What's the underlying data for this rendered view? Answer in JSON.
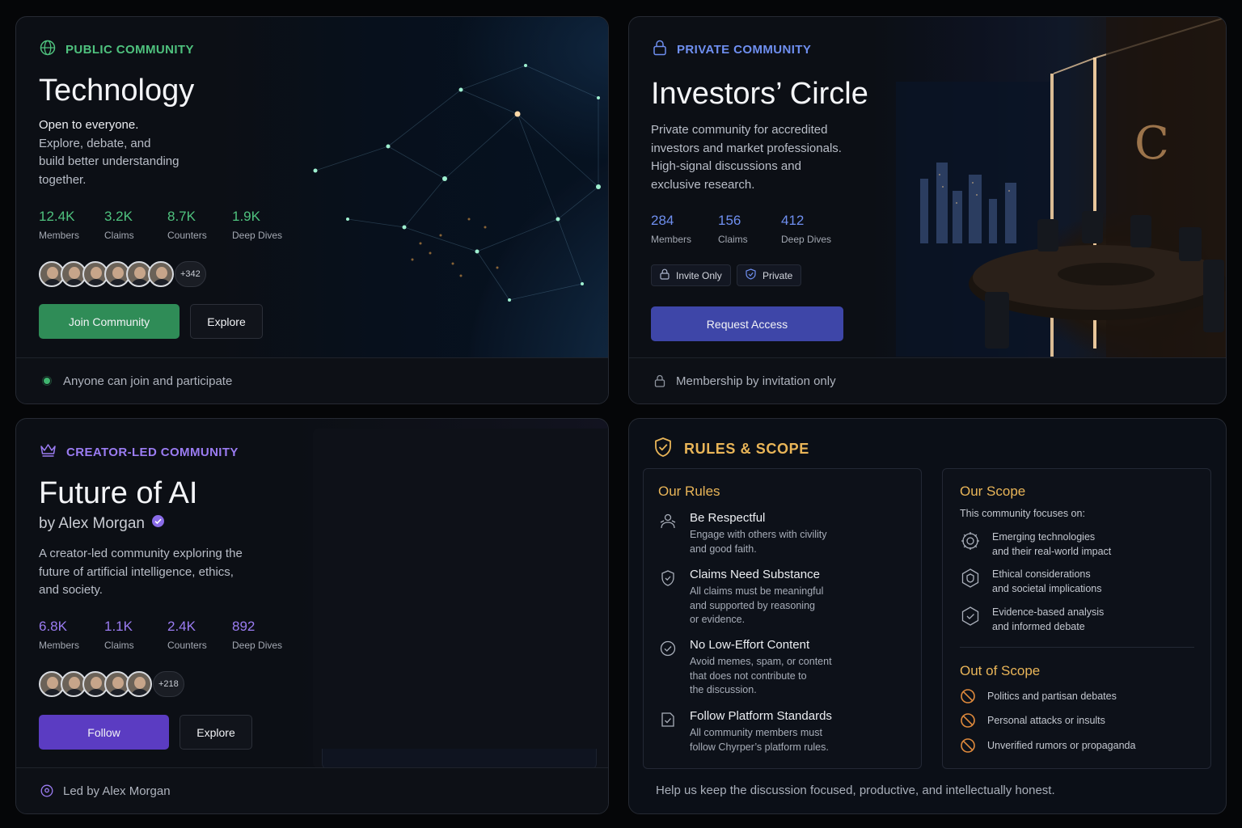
{
  "tech": {
    "kicker": "PUBLIC COMMUNITY",
    "title": "Technology",
    "desc_lead": "Open to everyone.",
    "desc_lines": [
      "Explore, debate, and",
      "build better understanding",
      "together."
    ],
    "stats": [
      {
        "value": "12.4K",
        "label": "Members"
      },
      {
        "value": "3.2K",
        "label": "Claims"
      },
      {
        "value": "8.7K",
        "label": "Counters"
      },
      {
        "value": "1.9K",
        "label": "Deep Dives"
      }
    ],
    "avatars_more": "+342",
    "join_label": "Join Community",
    "explore_label": "Explore",
    "footer": "Anyone can join and participate",
    "accent": "#4fc27e"
  },
  "investors": {
    "kicker": "PRIVATE COMMUNITY",
    "title": "Investors’ Circle",
    "desc_lines": [
      "Private community for accredited",
      "investors and market professionals.",
      "High-signal discussions and",
      "exclusive research."
    ],
    "stats": [
      {
        "value": "284",
        "label": "Members"
      },
      {
        "value": "156",
        "label": "Claims"
      },
      {
        "value": "412",
        "label": "Deep Dives"
      }
    ],
    "tag_invite": "Invite Only",
    "tag_private": "Private",
    "request_label": "Request Access",
    "footer": "Membership by invitation only",
    "accent": "#6f8ff0"
  },
  "ai": {
    "kicker": "CREATOR-LED COMMUNITY",
    "title": "Future of AI",
    "byline": "by Alex Morgan",
    "desc_lines": [
      "A creator-led community exploring the",
      "future of artificial intelligence, ethics,",
      "and society."
    ],
    "stats": [
      {
        "value": "6.8K",
        "label": "Members"
      },
      {
        "value": "1.1K",
        "label": "Claims"
      },
      {
        "value": "2.4K",
        "label": "Counters"
      },
      {
        "value": "892",
        "label": "Deep Dives"
      }
    ],
    "avatars_more": "+218",
    "follow_label": "Follow",
    "explore_label": "Explore",
    "footer": "Led by Alex Morgan",
    "accent": "#9b7cf2"
  },
  "rules": {
    "heading": "RULES & SCOPE",
    "our_rules_title": "Our Rules",
    "items": [
      {
        "title": "Be Respectful",
        "lines": [
          "Engage with others with civility",
          "and good faith."
        ]
      },
      {
        "title": "Claims Need Substance",
        "lines": [
          "All claims must be meaningful",
          "and supported by reasoning",
          "or evidence."
        ]
      },
      {
        "title": "No Low-Effort Content",
        "lines": [
          "Avoid memes, spam, or content",
          "that does not contribute to",
          "the discussion."
        ]
      },
      {
        "title": "Follow Platform Standards",
        "lines": [
          "All community members must",
          "follow Chyrper’s platform rules."
        ]
      }
    ],
    "scope_title": "Our Scope",
    "scope_intro": "This community focuses on:",
    "scope_items": [
      {
        "lines": [
          "Emerging technologies",
          "and their real-world impact"
        ]
      },
      {
        "lines": [
          "Ethical considerations",
          "and societal implications"
        ]
      },
      {
        "lines": [
          "Evidence-based analysis",
          "and informed debate"
        ]
      }
    ],
    "out_title": "Out of Scope",
    "out_items": [
      "Politics and partisan debates",
      "Personal attacks or insults",
      "Unverified rumors or propaganda"
    ],
    "footer": "Help us keep the discussion focused, productive, and intellectually honest.",
    "accent": "#e9b558"
  }
}
